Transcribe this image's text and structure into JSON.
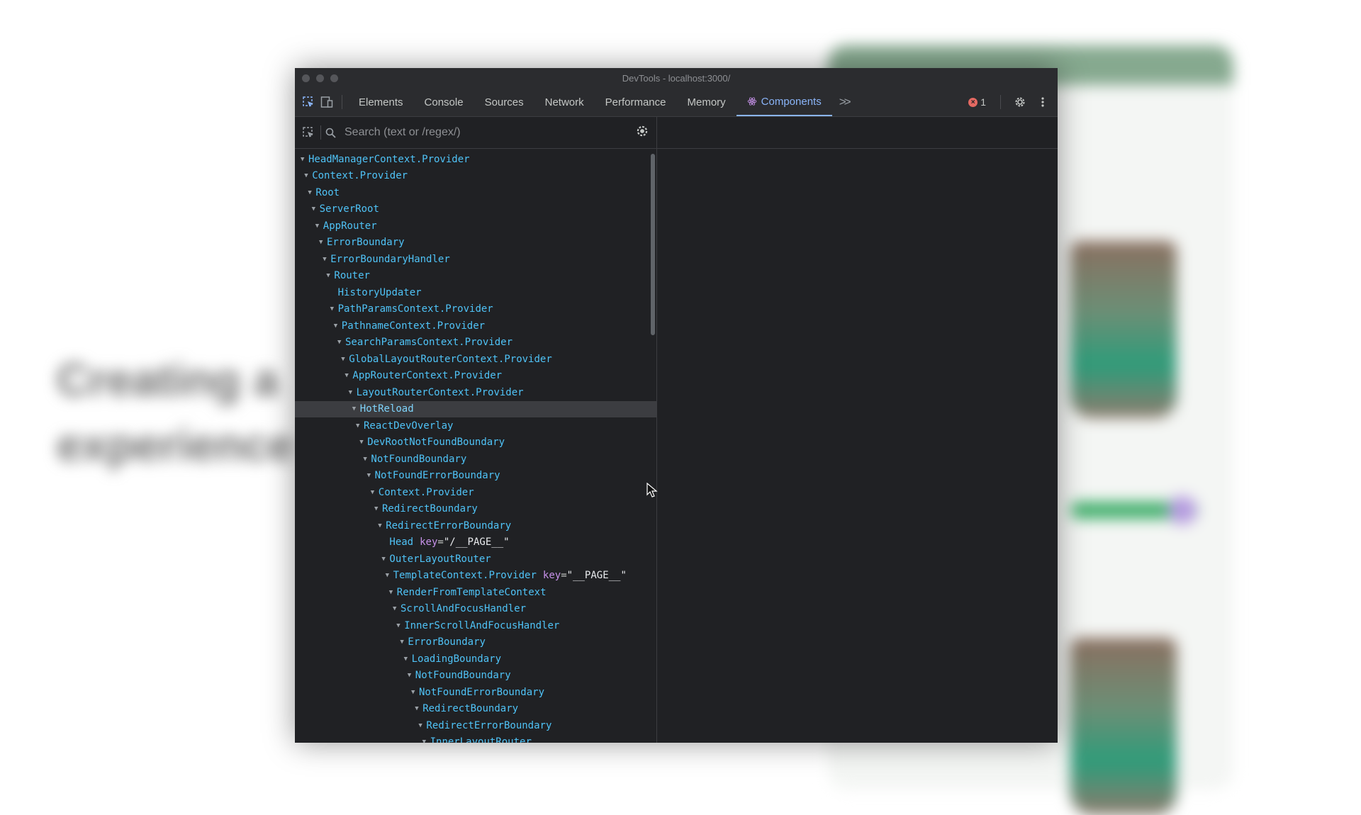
{
  "background": {
    "heading": "Creating a\nexperience"
  },
  "window": {
    "title": "DevTools - localhost:3000/"
  },
  "toolbar": {
    "tabs": [
      {
        "label": "Elements",
        "active": false
      },
      {
        "label": "Console",
        "active": false
      },
      {
        "label": "Sources",
        "active": false
      },
      {
        "label": "Network",
        "active": false
      },
      {
        "label": "Performance",
        "active": false
      },
      {
        "label": "Memory",
        "active": false
      },
      {
        "label": "Components",
        "active": true
      }
    ],
    "more_tabs_icon": "double-chevron-right-icon",
    "error_count": "1"
  },
  "search": {
    "placeholder": "Search (text or /regex/)",
    "value": ""
  },
  "tree": {
    "selected_index": 15,
    "rows": [
      {
        "depth": 0,
        "name": "HeadManagerContext.Provider",
        "expanded": true
      },
      {
        "depth": 1,
        "name": "Context.Provider",
        "expanded": true
      },
      {
        "depth": 2,
        "name": "Root",
        "expanded": true
      },
      {
        "depth": 3,
        "name": "ServerRoot",
        "expanded": true
      },
      {
        "depth": 4,
        "name": "AppRouter",
        "expanded": true
      },
      {
        "depth": 5,
        "name": "ErrorBoundary",
        "expanded": true
      },
      {
        "depth": 6,
        "name": "ErrorBoundaryHandler",
        "expanded": true
      },
      {
        "depth": 7,
        "name": "Router",
        "expanded": true
      },
      {
        "depth": 8,
        "name": "HistoryUpdater",
        "expanded": false
      },
      {
        "depth": 8,
        "name": "PathParamsContext.Provider",
        "expanded": true
      },
      {
        "depth": 9,
        "name": "PathnameContext.Provider",
        "expanded": true
      },
      {
        "depth": 10,
        "name": "SearchParamsContext.Provider",
        "expanded": true
      },
      {
        "depth": 11,
        "name": "GlobalLayoutRouterContext.Provider",
        "expanded": true
      },
      {
        "depth": 12,
        "name": "AppRouterContext.Provider",
        "expanded": true
      },
      {
        "depth": 13,
        "name": "LayoutRouterContext.Provider",
        "expanded": true
      },
      {
        "depth": 14,
        "name": "HotReload",
        "expanded": true
      },
      {
        "depth": 15,
        "name": "ReactDevOverlay",
        "expanded": true
      },
      {
        "depth": 16,
        "name": "DevRootNotFoundBoundary",
        "expanded": true
      },
      {
        "depth": 17,
        "name": "NotFoundBoundary",
        "expanded": true
      },
      {
        "depth": 18,
        "name": "NotFoundErrorBoundary",
        "expanded": true
      },
      {
        "depth": 19,
        "name": "Context.Provider",
        "expanded": true
      },
      {
        "depth": 20,
        "name": "RedirectBoundary",
        "expanded": true
      },
      {
        "depth": 21,
        "name": "RedirectErrorBoundary",
        "expanded": true
      },
      {
        "depth": 22,
        "name": "Head",
        "expanded": false,
        "prop_key": "key",
        "prop_value": "\"/__PAGE__\""
      },
      {
        "depth": 22,
        "name": "OuterLayoutRouter",
        "expanded": true
      },
      {
        "depth": 23,
        "name": "TemplateContext.Provider",
        "expanded": true,
        "prop_key": "key",
        "prop_value": "\"__PAGE__\""
      },
      {
        "depth": 24,
        "name": "RenderFromTemplateContext",
        "expanded": true
      },
      {
        "depth": 25,
        "name": "ScrollAndFocusHandler",
        "expanded": true
      },
      {
        "depth": 26,
        "name": "InnerScrollAndFocusHandler",
        "expanded": true
      },
      {
        "depth": 27,
        "name": "ErrorBoundary",
        "expanded": true
      },
      {
        "depth": 28,
        "name": "LoadingBoundary",
        "expanded": true
      },
      {
        "depth": 29,
        "name": "NotFoundBoundary",
        "expanded": true
      },
      {
        "depth": 30,
        "name": "NotFoundErrorBoundary",
        "expanded": true
      },
      {
        "depth": 31,
        "name": "RedirectBoundary",
        "expanded": true
      },
      {
        "depth": 32,
        "name": "RedirectErrorBoundary",
        "expanded": true
      },
      {
        "depth": 33,
        "name": "InnerLayoutRouter",
        "expanded": true
      }
    ]
  }
}
